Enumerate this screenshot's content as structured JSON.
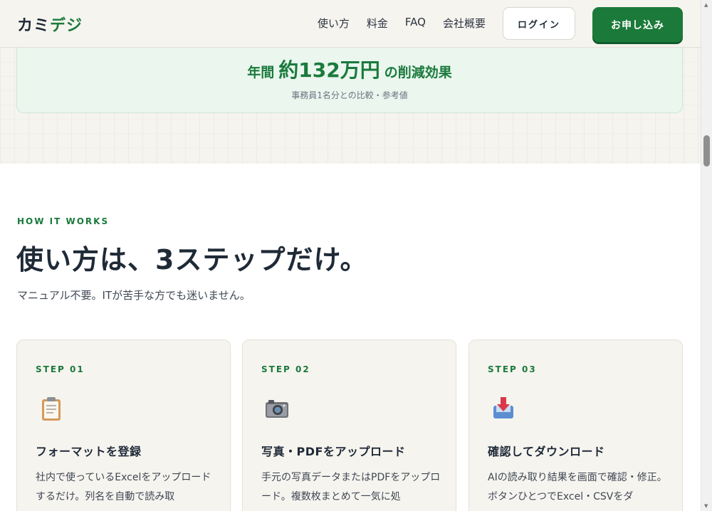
{
  "header": {
    "logo_main": "カミ",
    "logo_accent": "デジ",
    "nav": [
      "使い方",
      "料金",
      "FAQ",
      "会社概要"
    ],
    "login_label": "ログイン",
    "apply_label": "お申し込み"
  },
  "savings": {
    "prefix": "年間",
    "amount": "約132万円",
    "suffix": "の削減効果",
    "note": "事務員1名分との比較・参考値"
  },
  "how_it_works": {
    "eyebrow": "HOW IT WORKS",
    "title": "使い方は、3ステップだけ。",
    "subtitle": "マニュアル不要。ITが苦手な方でも迷いません。",
    "steps": [
      {
        "label": "STEP 01",
        "icon": "clipboard-icon",
        "title": "フォーマットを登録",
        "desc": "社内で使っているExcelをアップロードするだけ。列名を自動で読み取"
      },
      {
        "label": "STEP 02",
        "icon": "camera-icon",
        "title": "写真・PDFをアップロード",
        "desc": "手元の写真データまたはPDFをアップロード。複数枚まとめて一気に処"
      },
      {
        "label": "STEP 03",
        "icon": "download-tray-icon",
        "title": "確認してダウンロード",
        "desc": "AIの読み取り結果を画面で確認・修正。ボタンひとつでExcel・CSVをダ"
      }
    ]
  },
  "colors": {
    "brand_green": "#1a7a3c",
    "bg_cream": "#f6f4ef",
    "savings_bg": "#eaf6ee",
    "text_dark": "#1f2a37"
  }
}
